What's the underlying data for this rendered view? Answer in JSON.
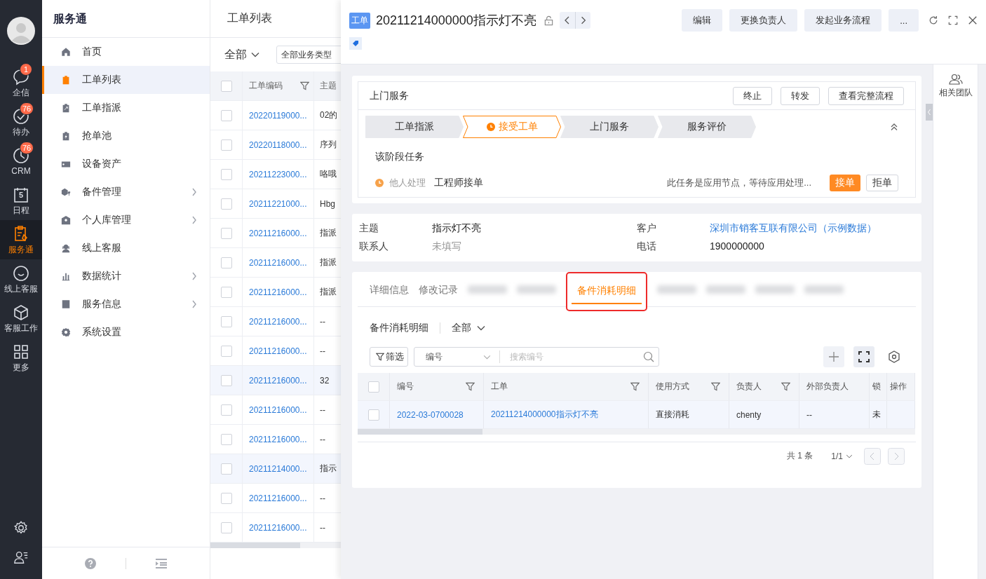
{
  "rail": {
    "items": [
      {
        "label": "企信",
        "kind": "chat",
        "badge": "1",
        "selected": false
      },
      {
        "label": "待办",
        "kind": "check",
        "badge": "76",
        "selected": false
      },
      {
        "label": "CRM",
        "kind": "clock",
        "badge": "76",
        "selected": false
      },
      {
        "label": "日程",
        "kind": "calendar",
        "day": "5",
        "selected": false
      },
      {
        "label": "服务通",
        "kind": "service",
        "selected": true
      },
      {
        "label": "线上客服",
        "kind": "smile",
        "selected": false
      },
      {
        "label": "客服工作",
        "kind": "cube",
        "selected": false
      },
      {
        "label": "更多",
        "kind": "grid",
        "selected": false
      }
    ]
  },
  "menu": {
    "title": "服务通",
    "items": [
      {
        "label": "首页",
        "kind": "home",
        "selected": false,
        "expandable": false
      },
      {
        "label": "工单列表",
        "kind": "clipboard",
        "selected": true,
        "expandable": false
      },
      {
        "label": "工单指派",
        "kind": "assign",
        "selected": false,
        "expandable": false
      },
      {
        "label": "抢单池",
        "kind": "pool",
        "selected": false,
        "expandable": false
      },
      {
        "label": "设备资产",
        "kind": "device",
        "selected": false,
        "expandable": false
      },
      {
        "label": "备件管理",
        "kind": "parts",
        "selected": false,
        "expandable": true
      },
      {
        "label": "个人库管理",
        "kind": "store",
        "selected": false,
        "expandable": true
      },
      {
        "label": "线上客服",
        "kind": "agent",
        "selected": false,
        "expandable": false
      },
      {
        "label": "数据统计",
        "kind": "chart",
        "selected": false,
        "expandable": true
      },
      {
        "label": "服务信息",
        "kind": "info",
        "selected": false,
        "expandable": true
      },
      {
        "label": "系统设置",
        "kind": "gear",
        "selected": false,
        "expandable": false
      }
    ]
  },
  "list": {
    "title": "工单列表",
    "filter": "全部",
    "type_select": "全部业务类型",
    "all_checked": false,
    "columns": [
      "工单编码",
      "主题"
    ],
    "rows": [
      {
        "code": "20220119000...",
        "subject": "02的",
        "selected": false,
        "checked": false
      },
      {
        "code": "20220118000...",
        "subject": "序列",
        "selected": false,
        "checked": false
      },
      {
        "code": "20211223000...",
        "subject": "咯哦",
        "selected": false,
        "checked": false
      },
      {
        "code": "20211221000...",
        "subject": "Hbg",
        "selected": false,
        "checked": false
      },
      {
        "code": "20211216000...",
        "subject": "指派",
        "selected": false,
        "checked": false
      },
      {
        "code": "20211216000...",
        "subject": "指派",
        "selected": false,
        "checked": false
      },
      {
        "code": "20211216000...",
        "subject": "指派",
        "selected": false,
        "checked": false
      },
      {
        "code": "20211216000...",
        "subject": "--",
        "selected": false,
        "checked": false
      },
      {
        "code": "20211216000...",
        "subject": "--",
        "selected": false,
        "checked": false
      },
      {
        "code": "20211216000...",
        "subject": "32",
        "selected": true,
        "checked": false
      },
      {
        "code": "20211216000...",
        "subject": "--",
        "selected": false,
        "checked": false
      },
      {
        "code": "20211216000...",
        "subject": "--",
        "selected": false,
        "checked": false
      },
      {
        "code": "20211214000...",
        "subject": "指示",
        "selected": true,
        "checked": false
      },
      {
        "code": "20211216000...",
        "subject": "--",
        "selected": false,
        "checked": false
      },
      {
        "code": "20211216000...",
        "subject": "--",
        "selected": false,
        "checked": false
      }
    ]
  },
  "detail": {
    "tag": "工单",
    "title": "20211214000000指示灯不亮",
    "actions": [
      "编辑",
      "更换负责人",
      "发起业务流程",
      "..."
    ],
    "stage_card": {
      "title": "上门服务",
      "buttons": [
        "终止",
        "转发",
        "查看完整流程"
      ],
      "steps": [
        {
          "label": "工单指派",
          "selected": false
        },
        {
          "label": "接受工单",
          "selected": true
        },
        {
          "label": "上门服务",
          "selected": false
        },
        {
          "label": "服务评价",
          "selected": false
        }
      ],
      "task_heading": "该阶段任务",
      "task": {
        "status": "他人处理",
        "name": "工程师接单",
        "note": "此任务是应用节点，等待应用处理...",
        "buttons": [
          {
            "label": "接单",
            "kind": "primary"
          },
          {
            "label": "拒单",
            "kind": "plain"
          }
        ]
      }
    },
    "info": [
      {
        "label": "主题",
        "value": "指示灯不亮",
        "kind": "text"
      },
      {
        "label": "客户",
        "value": "深圳市销客互联有限公司（示例数据）",
        "kind": "link"
      },
      {
        "label": "联系人",
        "value": "未填写",
        "kind": "empty"
      },
      {
        "label": "电话",
        "value": "1900000000",
        "kind": "text"
      }
    ],
    "tabs": [
      {
        "label": "详细信息",
        "kind": "text",
        "selected": false
      },
      {
        "label": "修改记录",
        "kind": "text",
        "selected": false
      },
      {
        "kind": "blurred",
        "selected": false
      },
      {
        "kind": "blurred",
        "selected": false
      },
      {
        "label": "备件消耗明细",
        "kind": "text",
        "selected": true
      },
      {
        "kind": "blurred",
        "selected": false
      },
      {
        "kind": "blurred",
        "selected": false
      },
      {
        "kind": "blurred",
        "selected": false
      },
      {
        "kind": "blurred",
        "selected": false
      }
    ],
    "sub": {
      "title": "备件消耗明细",
      "filter": "全部",
      "filter_button": "筛选",
      "search_field": "编号",
      "search_placeholder": "搜索编号",
      "all_checked": false,
      "columns": [
        {
          "label": "编号",
          "filter": true
        },
        {
          "label": "工单",
          "filter": true
        },
        {
          "label": "使用方式",
          "filter": true
        },
        {
          "label": "负责人",
          "filter": true
        },
        {
          "label": "外部负责人",
          "filter": false
        },
        {
          "label": "锁",
          "filter": false
        },
        {
          "label": "操作",
          "filter": false
        }
      ],
      "rows": [
        {
          "cells": [
            "2022-03-0700028",
            "20211214000000指示灯不亮",
            "直接消耗",
            "chenty",
            "--",
            "未"
          ],
          "checked": false
        }
      ],
      "total": "共 1 条",
      "page": "1/1"
    },
    "side_panel": {
      "label": "相关团队"
    }
  }
}
